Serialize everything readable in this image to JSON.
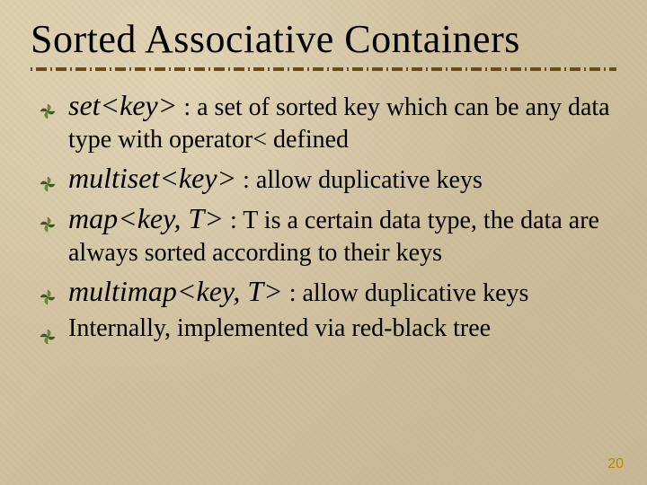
{
  "title": "Sorted Associative Containers",
  "bullets": [
    {
      "term": "set<key>",
      "desc": " : a set of sorted key which can be any data type with operator< defined"
    },
    {
      "term": "multiset<key>",
      "desc": " : allow duplicative keys"
    },
    {
      "term": "map<key, T>",
      "desc": " : T is a certain data type, the data are always sorted according to their keys"
    },
    {
      "term": "multimap<key, T>",
      "desc": " : allow duplicative keys"
    },
    {
      "term": "",
      "desc": "Internally, implemented via red-black tree"
    }
  ],
  "page_number": "20",
  "colors": {
    "bullet_fill": "#3a5a2a",
    "bullet_accent": "#6b8e23",
    "rule": "#6b4a18",
    "pagenum": "#b8860b"
  }
}
